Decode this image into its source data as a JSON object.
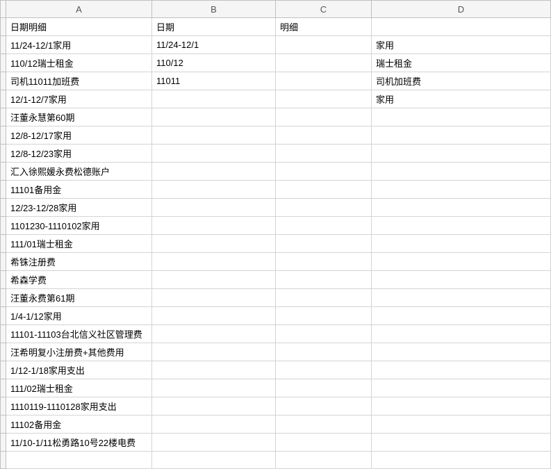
{
  "columns": [
    "A",
    "B",
    "C",
    "D"
  ],
  "rows": [
    {
      "a": "日期明细",
      "b": "日期",
      "c": "明细",
      "d": ""
    },
    {
      "a": "11/24-12/1家用",
      "b": "11/24-12/1",
      "c": "",
      "d": "家用"
    },
    {
      "a": "110/12瑞士租金",
      "b": "110/12",
      "c": "",
      "d": "瑞士租金"
    },
    {
      "a": "司机11011加班费",
      "b": "11011",
      "c": "",
      "d": "司机加班费"
    },
    {
      "a": "12/1-12/7家用",
      "b": "",
      "c": "",
      "d": "家用"
    },
    {
      "a": "汪董永慧第60期",
      "b": "",
      "c": "",
      "d": ""
    },
    {
      "a": "12/8-12/17家用",
      "b": "",
      "c": "",
      "d": ""
    },
    {
      "a": "12/8-12/23家用",
      "b": "",
      "c": "",
      "d": ""
    },
    {
      "a": "汇入徐熙媛永费松德账户",
      "b": "",
      "c": "",
      "d": ""
    },
    {
      "a": "11101备用金",
      "b": "",
      "c": "",
      "d": ""
    },
    {
      "a": "12/23-12/28家用",
      "b": "",
      "c": "",
      "d": ""
    },
    {
      "a": "1101230-1110102家用",
      "b": "",
      "c": "",
      "d": ""
    },
    {
      "a": "111/01瑞士租金",
      "b": "",
      "c": "",
      "d": ""
    },
    {
      "a": "希铢注册费",
      "b": "",
      "c": "",
      "d": ""
    },
    {
      "a": "希森学费",
      "b": "",
      "c": "",
      "d": ""
    },
    {
      "a": "汪董永费第61期",
      "b": "",
      "c": "",
      "d": ""
    },
    {
      "a": "1/4-1/12家用",
      "b": "",
      "c": "",
      "d": ""
    },
    {
      "a": "11101-11103台北信义社区管理费",
      "b": "",
      "c": "",
      "d": ""
    },
    {
      "a": "汪希明复小注册费+其他费用",
      "b": "",
      "c": "",
      "d": ""
    },
    {
      "a": "1/12-1/18家用支出",
      "b": "",
      "c": "",
      "d": ""
    },
    {
      "a": "111/02瑞士租金",
      "b": "",
      "c": "",
      "d": ""
    },
    {
      "a": "1110119-1110128家用支出",
      "b": "",
      "c": "",
      "d": ""
    },
    {
      "a": "11102备用金",
      "b": "",
      "c": "",
      "d": ""
    },
    {
      "a": "11/10-1/11松勇路10号22楼电费",
      "b": "",
      "c": "",
      "d": ""
    },
    {
      "a": "",
      "b": "",
      "c": "",
      "d": ""
    }
  ]
}
